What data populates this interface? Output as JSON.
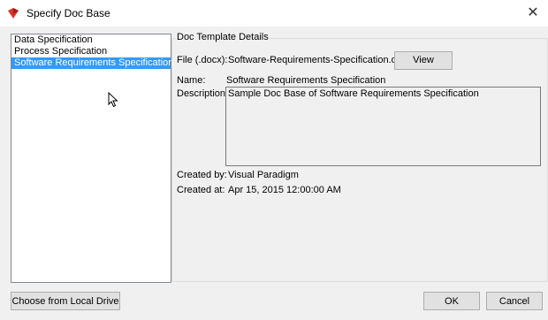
{
  "window": {
    "title": "Specify Doc Base",
    "close_glyph": "✕",
    "accent": "#3399ff"
  },
  "doc_base_list": {
    "items": [
      {
        "label": "Data Specification",
        "selected": false
      },
      {
        "label": "Process Specification",
        "selected": false
      },
      {
        "label": "Software Requirements Specification",
        "selected": true
      }
    ]
  },
  "details": {
    "group_title": "Doc Template Details",
    "file_label": "File (.docx):",
    "file_value": "Software-Requirements-Specification.docx",
    "view_button": "View",
    "name_label": "Name:",
    "name_value": "Software Requirements Specification",
    "description_label": "Description:",
    "description_value": "Sample Doc Base of Software Requirements Specification",
    "created_by_label": "Created by:",
    "created_by_value": "Visual Paradigm",
    "created_at_label": "Created at:",
    "created_at_value": "Apr 15, 2015 12:00:00 AM"
  },
  "footer": {
    "choose_button": "Choose from Local Drive",
    "ok_button": "OK",
    "cancel_button": "Cancel"
  }
}
